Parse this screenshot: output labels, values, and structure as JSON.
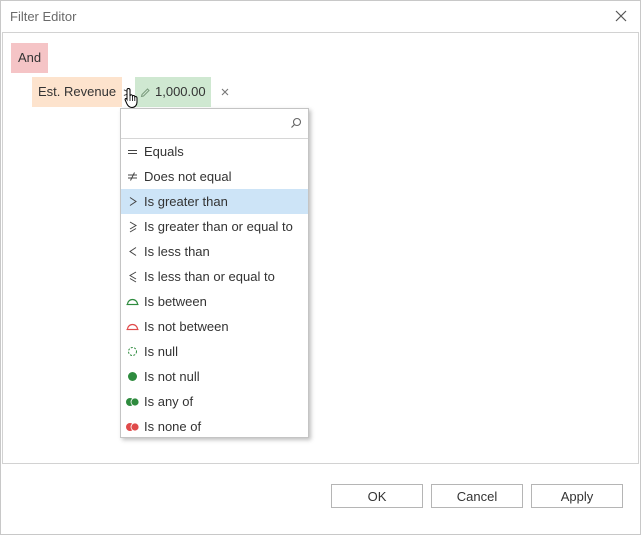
{
  "window": {
    "title": "Filter Editor"
  },
  "filter": {
    "group_operator": "And",
    "condition": {
      "field": "Est. Revenue",
      "operator_symbol": ">",
      "value": "1,000.00"
    }
  },
  "dropdown": {
    "search": {
      "value": "",
      "placeholder": ""
    },
    "selected_index": 2,
    "operators": [
      {
        "label": "Equals",
        "icon": "equals-icon"
      },
      {
        "label": "Does not equal",
        "icon": "not-equal-icon"
      },
      {
        "label": "Is greater than",
        "icon": "greater-than-icon"
      },
      {
        "label": "Is greater than or equal to",
        "icon": "greater-or-equal-icon"
      },
      {
        "label": "Is less than",
        "icon": "less-than-icon"
      },
      {
        "label": "Is less than or equal to",
        "icon": "less-or-equal-icon"
      },
      {
        "label": "Is between",
        "icon": "between-icon"
      },
      {
        "label": "Is not between",
        "icon": "not-between-icon"
      },
      {
        "label": "Is null",
        "icon": "null-icon"
      },
      {
        "label": "Is not null",
        "icon": "not-null-icon"
      },
      {
        "label": "Is any of",
        "icon": "any-of-icon"
      },
      {
        "label": "Is none of",
        "icon": "none-of-icon"
      }
    ]
  },
  "buttons": {
    "ok": "OK",
    "cancel": "Cancel",
    "apply": "Apply"
  },
  "colors": {
    "group_operator_bg": "#f5c4c6",
    "field_bg": "#fde3cd",
    "value_bg": "#cfe8d1",
    "selected_item_bg": "#cde4f7",
    "green": "#2e8b3e",
    "red": "#e04a4a"
  }
}
